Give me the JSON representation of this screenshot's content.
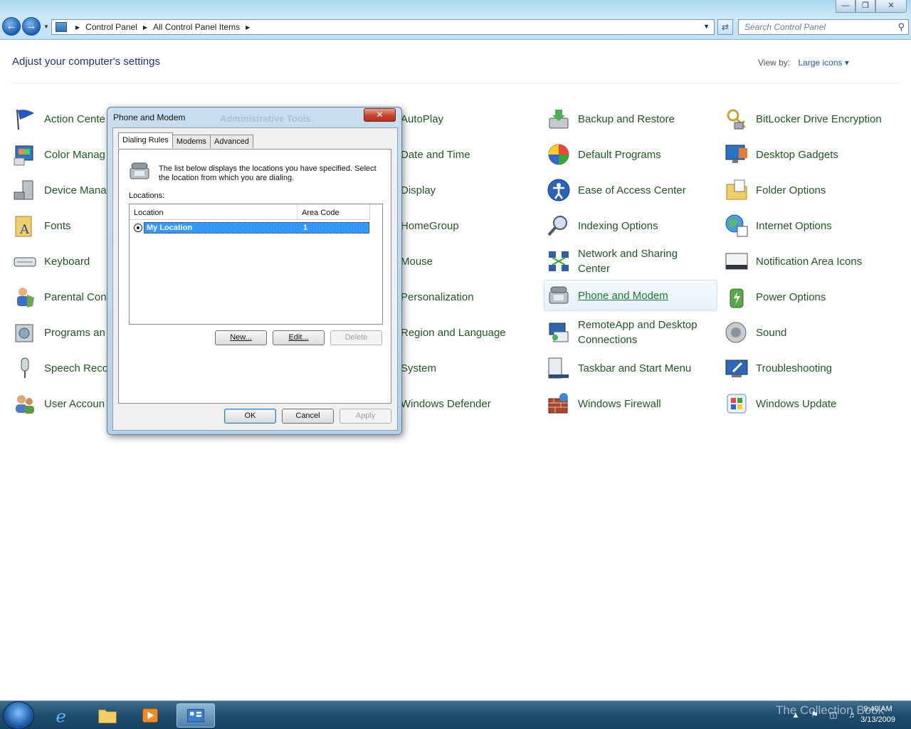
{
  "window": {
    "controls": [
      "minimize-icon",
      "restore-icon",
      "close-icon"
    ]
  },
  "breadcrumb": {
    "root": "Control Panel",
    "current": "All Control Panel Items"
  },
  "search": {
    "placeholder": "Search Control Panel"
  },
  "header": {
    "title": "Adjust your computer's settings",
    "view_by_label": "View by:",
    "view_by_value": "Large icons"
  },
  "items": {
    "col1": [
      "Action Center",
      "Color Management",
      "Device Manager",
      "Fonts",
      "Keyboard",
      "Parental Controls",
      "Programs and Features",
      "Speech Recognition",
      "User Accounts"
    ],
    "col2": [
      "AutoPlay",
      "Date and Time",
      "Display",
      "HomeGroup",
      "Mouse",
      "Personalization",
      "Region and Language",
      "System",
      "Windows Defender"
    ],
    "col3": [
      "Backup and Restore",
      "Default Programs",
      "Ease of Access Center",
      "Indexing Options",
      "Network and Sharing Center",
      "Phone and Modem",
      "RemoteApp and Desktop Connections",
      "Taskbar and Start Menu",
      "Windows Firewall"
    ],
    "col4": [
      "BitLocker Drive Encryption",
      "Desktop Gadgets",
      "Folder Options",
      "Internet Options",
      "Notification Area Icons",
      "Power Options",
      "Sound",
      "Troubleshooting",
      "Windows Update"
    ]
  },
  "visible_truncated": {
    "col1": [
      "Action Cente",
      "Color Manag",
      "Device Mana",
      "Fonts",
      "Keyboard",
      "Parental Con",
      "Programs an",
      "Speech Reco",
      "User Accoun"
    ]
  },
  "dialog": {
    "title": "Phone and Modem",
    "behind_title": "Administrative Tools",
    "tabs": [
      "Dialing Rules",
      "Modems",
      "Advanced"
    ],
    "active_tab": "Dialing Rules",
    "description": "The list below displays the locations you have specified. Select the location from which you are dialing.",
    "locations_label": "Locations:",
    "columns": [
      "Location",
      "Area Code"
    ],
    "rows": [
      {
        "location": "My Location",
        "area_code": "1",
        "selected": true
      }
    ],
    "buttons": {
      "new": "New...",
      "edit": "Edit...",
      "delete": "Delete"
    },
    "footer": {
      "ok": "OK",
      "cancel": "Cancel",
      "apply": "Apply"
    }
  },
  "taskbar": {
    "time": "9:40 AM",
    "date": "3/13/2009",
    "watermark": "The Collection Book"
  }
}
